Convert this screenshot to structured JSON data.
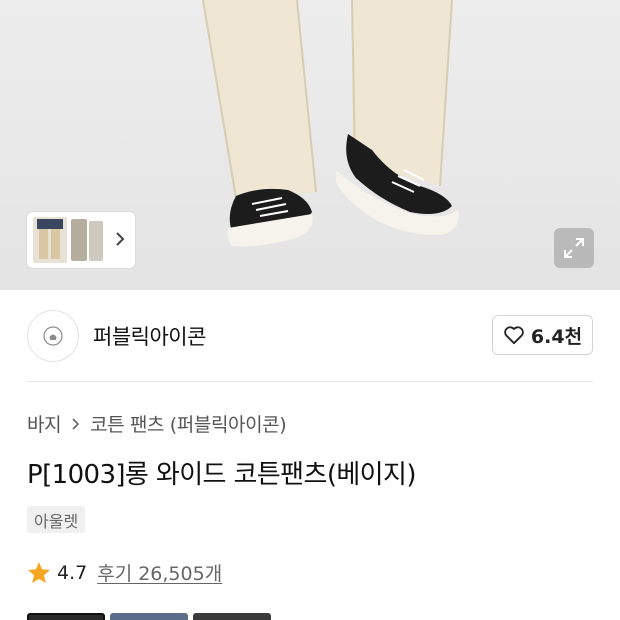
{
  "brand": {
    "name": "퍼블릭아이콘",
    "likes": "6.4천"
  },
  "breadcrumb": {
    "category": "바지",
    "subcategory": "코튼 팬츠 (퍼블릭아이콘)"
  },
  "product": {
    "title": "P[1003]롱 와이드 코튼팬츠(베이지)",
    "tag": "아울렛",
    "rating": "4.7",
    "reviews": "후기 26,505개"
  },
  "colors": {
    "star": "#f5a623",
    "pants": "#ece3d0",
    "background": "#e8e8e8"
  },
  "icons": {
    "like": "heart-icon",
    "expand": "expand-icon",
    "next": "chevron-right-icon",
    "breadcrumb_sep": "chevron-right-icon",
    "rating": "star-icon"
  }
}
